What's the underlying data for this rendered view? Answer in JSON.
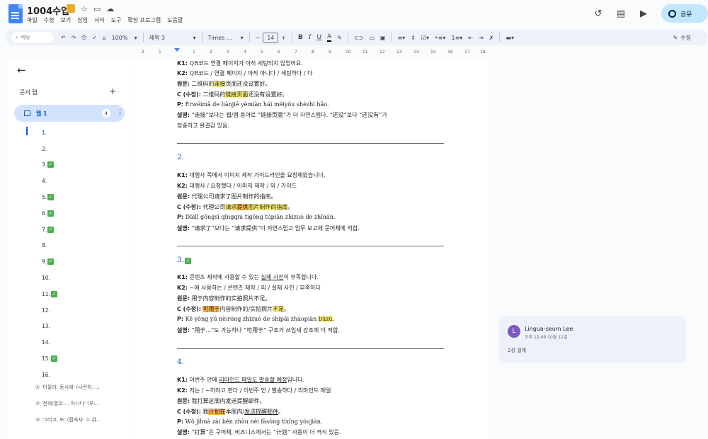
{
  "header": {
    "title": "1004수업",
    "menu": [
      "파일",
      "수정",
      "보기",
      "삽입",
      "서식",
      "도구",
      "확장 프로그램",
      "도움말"
    ],
    "share_label": "공유"
  },
  "toolbar": {
    "search_label": "메뉴",
    "zoom": "100%",
    "style": "제목 3",
    "font": "Times ...",
    "font_size": "14",
    "edit_mode": "수정"
  },
  "ruler": [
    "2",
    "1",
    "1",
    "2",
    "3",
    "4",
    "5",
    "6",
    "7",
    "8",
    "9",
    "10",
    "11",
    "12",
    "13",
    "14",
    "15",
    "16",
    "17",
    "18"
  ],
  "sidebar": {
    "tabs_title": "문서 탭",
    "tab_name": "탭 1",
    "tab_count": "4",
    "outline": [
      {
        "label": "1.",
        "checked": false
      },
      {
        "label": "2.",
        "checked": false
      },
      {
        "label": "3.",
        "checked": true
      },
      {
        "label": "4.",
        "checked": false
      },
      {
        "label": "5.",
        "checked": true
      },
      {
        "label": "6.",
        "checked": true
      },
      {
        "label": "7.",
        "checked": true
      },
      {
        "label": "8.",
        "checked": false
      },
      {
        "label": "9.",
        "checked": true
      },
      {
        "label": "10.",
        "checked": false
      },
      {
        "label": "11.",
        "checked": true
      },
      {
        "label": "12.",
        "checked": false
      },
      {
        "label": "13.",
        "checked": false
      },
      {
        "label": "14.",
        "checked": false
      },
      {
        "label": "15.",
        "checked": true
      },
      {
        "label": "16.",
        "checked": false
      }
    ],
    "sub_items": [
      "① '이울러, 동시에' (나란히, ...",
      "② '전혀/결코 ... 아니다' (부...",
      "③ '그리고, 또' (접속사: = 并..."
    ]
  },
  "doc": {
    "s1": {
      "k1_label": "K1:",
      "k1": " QR코드 연결 페이지가 아직 세팅되지 않았어요.",
      "k2_label": "K2:",
      "k2": " QR코드 / 연결 페이지 / 아직 아니다 / 세팅하다 / 다",
      "orig_label": "원문:",
      "orig_a": " 二维码的",
      "orig_hl": "连接",
      "orig_b": "页面还没设置好。",
      "c_label": "C (수정):",
      "c_a": " 二维码的",
      "c_hl": "链接页面",
      "c_b": "还没有设置好。",
      "p_label": "P:",
      "p": " Èrwéimǎ de liànjiē yèmiàn hái méiyǒu shèzhì hǎo.",
      "e_label": "설명:",
      "e": " “连接”보다는 웹/앱 용어로 “链接页面”가 더 자연스럽다. “还没”보다 “还没有”가",
      "e2": "정중하고 완결감 있음."
    },
    "s2": {
      "num": "2.",
      "k1_label": "K1:",
      "k1": " 대행사 쪽에서 이미지 제작 가이드라인을 요청해왔습니다.",
      "k2_label": "K2:",
      "k2": " 대행사 / 요청했다 / 이미지 제작 / 의 / 가이드",
      "orig_label": "원문:",
      "orig": " 代理公司请求了图片制作的指南。",
      "c_label": "C (수정):",
      "c_a": " 代理公司",
      "c_hl1": "请求",
      "c_hl2": "提供",
      "c_hl3": "图片制作的指南",
      "c_b": "。",
      "p_label": "P:",
      "p": " Dàilǐ gōngsī qǐngqiú tígōng túpiàn zhìzuò de zhǐnán.",
      "e_label": "설명:",
      "e": " “请求了”보다는 “请求提供”이 자연스럽고 업무 보고체 문어체에 적합."
    },
    "s3": {
      "num": "3.",
      "k1_label": "K1:",
      "k1_a": " 콘텐츠 제작에 사용할 수 있는 ",
      "k1_ul": "실제 사진",
      "k1_b": "이 부족합니다.",
      "k2_label": "K2:",
      "k2": " ~에 사용하는 / 콘텐츠 제작 / 의 / 실제 사진 / 부족하다",
      "orig_label": "원문:",
      "orig": " 用于内容制作的实拍照片不足。",
      "c_label": "C (수정):",
      "c_hl1": "可用于",
      "c_a": "内容制作的/实拍照片",
      "c_hl2": "不足",
      "c_b": "。",
      "p_label": "P:",
      "p_a": " Kě yòng yú nèiróng zhìzuò de shípāi zhàopiàn ",
      "p_hl": "bùzú",
      "p_b": ".",
      "e_label": "설명:",
      "e": " “用于...”도 가능하나 “可用于” 구조가 쓰임새 강조에 더 적합."
    },
    "s4": {
      "num": "4.",
      "k1_label": "K1:",
      "k1_a": " 이번주 안에 ",
      "k1_ul": "리마인드 메일도 발송할 예정",
      "k1_b": "입니다.",
      "k2_label": "K2:",
      "k2": " 저는 / ~하려고 한다 / 이번주 안 / 발송하다 / 리마인드 메일",
      "orig_label": "원문:",
      "orig": " 我打算这周内发送提醒邮件。",
      "c_label": "C (수정):",
      "c_a": " 我",
      "c_hl": "计划在",
      "c_b": "本周内/",
      "c_ul": "发送提醒邮件",
      "c_c": "。",
      "p_label": "P:",
      "p": " Wǒ jìhuà zài běn zhōu nèi fāsòng tíxǐng yóujiàn.",
      "e_label": "설명:",
      "e": " “打算”은 구어체, 비즈니스에서는 “计划” 사용이 더 격식 있음."
    }
  },
  "comment": {
    "avatar": "L",
    "author": "Lingua-seum Lee",
    "time": "오후 12:49 10월 11일",
    "reply": "2성 걸게"
  }
}
